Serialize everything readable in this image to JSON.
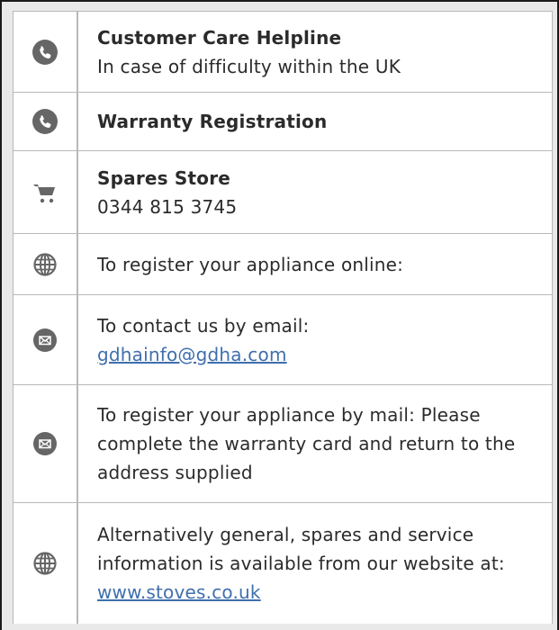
{
  "rows": [
    {
      "icon": "phone-icon",
      "title": "Customer Care Helpline",
      "text": "In case of difficulty within the UK"
    },
    {
      "icon": "phone-icon",
      "title": "Warranty Registration"
    },
    {
      "icon": "cart-icon",
      "title": "Spares Store",
      "text": "0344 815 3745"
    },
    {
      "icon": "globe-icon",
      "text": "To register your appliance online:"
    },
    {
      "icon": "mail-icon",
      "text": "To contact us by email:",
      "link": "gdhainfo@gdha.com"
    },
    {
      "icon": "mail-icon",
      "text": "To register your appliance by mail: Please complete the warranty card and return to the address supplied"
    },
    {
      "icon": "globe-icon",
      "text": "Alternatively general, spares and service information is available from our website at:",
      "link": "www.stoves.co.uk"
    }
  ],
  "colors": {
    "icon": "#666666",
    "link": "#3f6fae",
    "border": "#b8b8b8"
  }
}
